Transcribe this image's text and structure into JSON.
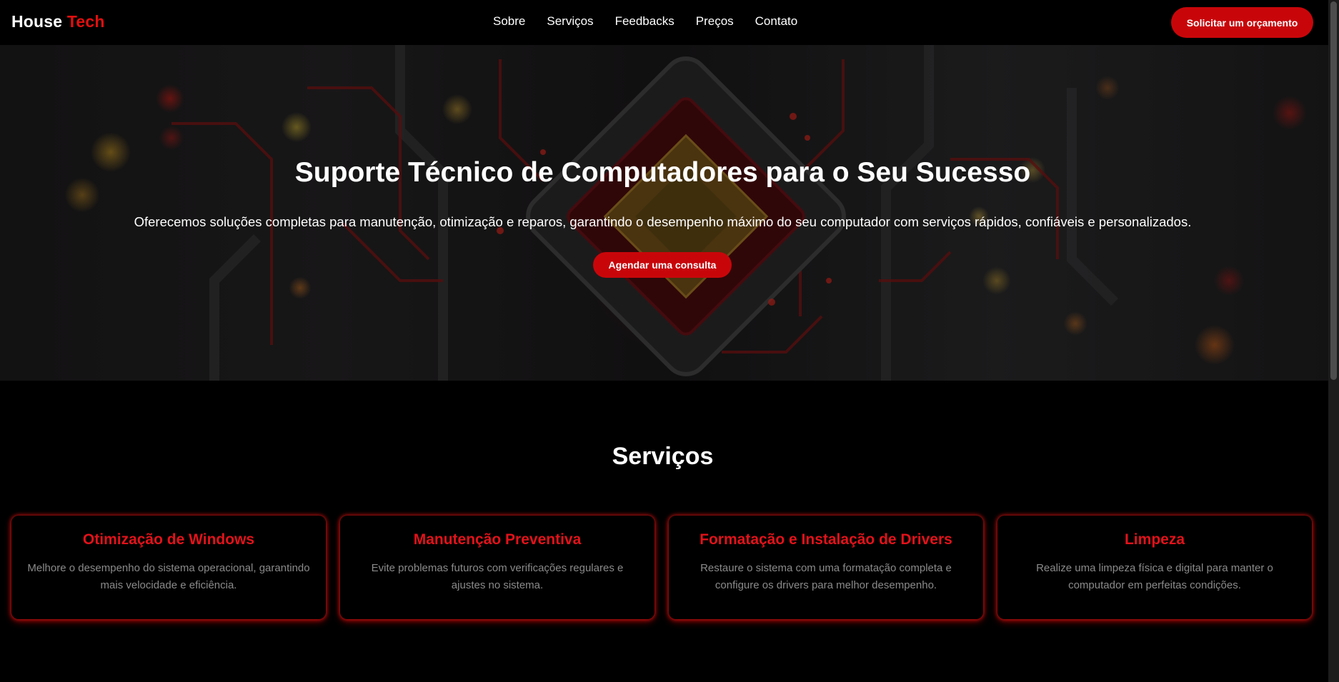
{
  "header": {
    "logo_part1": "House",
    "logo_part2": "Tech",
    "nav": [
      "Sobre",
      "Serviços",
      "Feedbacks",
      "Preços",
      "Contato"
    ],
    "cta_label": "Solicitar um orçamento"
  },
  "hero": {
    "title": "Suporte Técnico de Computadores para o Seu Sucesso",
    "subtitle": "Oferecemos soluções completas para manutenção, otimização e reparos, garantindo o desempenho máximo do seu computador com serviços rápidos, confiáveis e personalizados.",
    "button_label": "Agendar uma consulta"
  },
  "services": {
    "title": "Serviços",
    "items": [
      {
        "title": "Otimização de Windows",
        "description": "Melhore o desempenho do sistema operacional, garantindo mais velocidade e eficiência."
      },
      {
        "title": "Manutenção Preventiva",
        "description": "Evite problemas futuros com verificações regulares e ajustes no sistema."
      },
      {
        "title": "Formatação e Instalação de Drivers",
        "description": "Restaure o sistema com uma formatação completa e configure os drivers para melhor desempenho."
      },
      {
        "title": "Limpeza",
        "description": "Realize uma limpeza física e digital para manter o computador em perfeitas condições."
      }
    ]
  },
  "colors": {
    "accent": "#c8060a",
    "accent_text": "#e2121a",
    "background": "#000000"
  }
}
